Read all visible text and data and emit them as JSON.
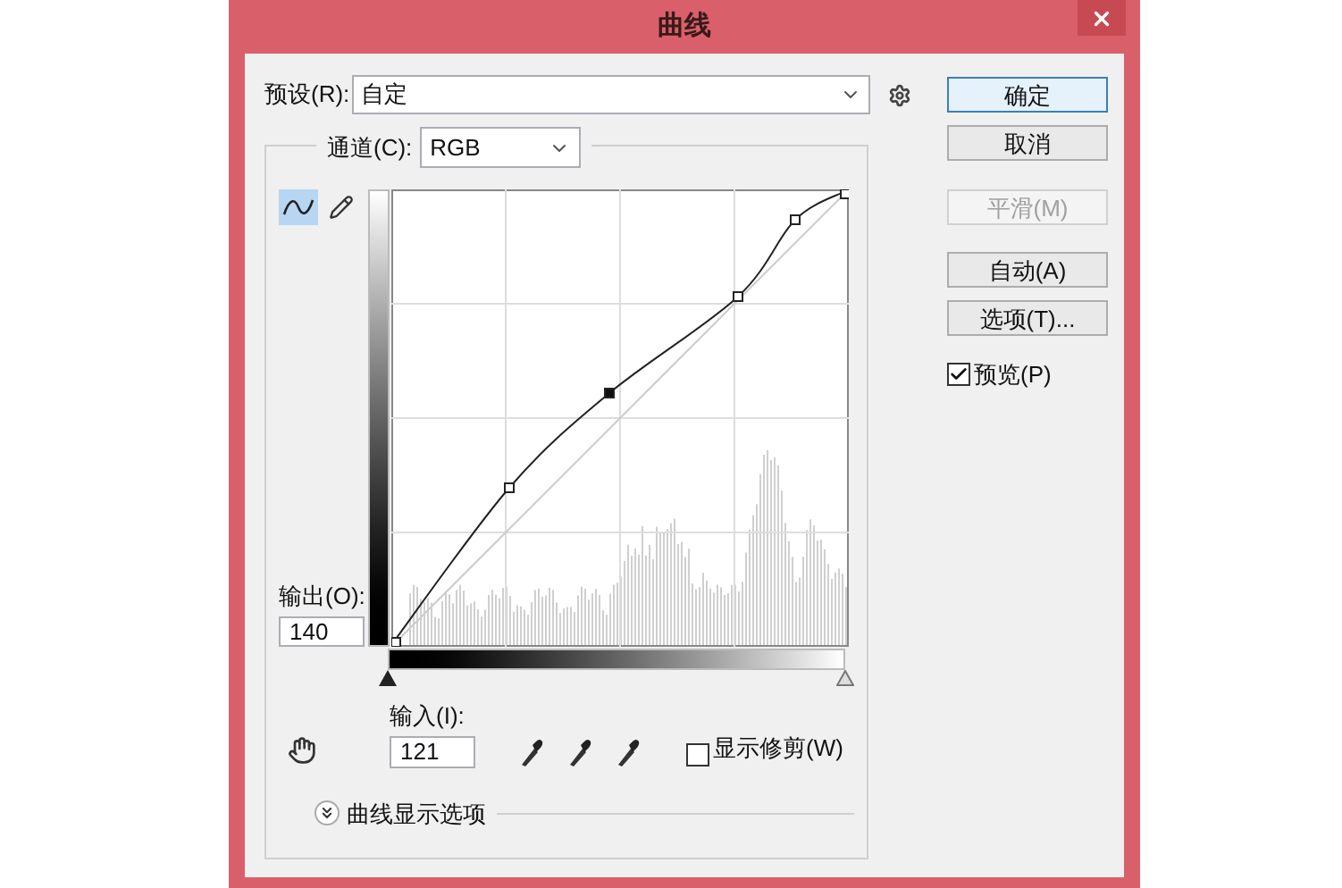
{
  "window": {
    "title": "曲线"
  },
  "preset": {
    "label": "预设(R):",
    "value": "自定"
  },
  "channel": {
    "label": "通道(C):",
    "value": "RGB"
  },
  "tools": [
    {
      "kind": "curve",
      "selected": true
    },
    {
      "kind": "pencil",
      "selected": false
    }
  ],
  "output": {
    "label": "输出(O):",
    "value": "140"
  },
  "input": {
    "label": "输入(I):",
    "value": "121"
  },
  "show_clipping": {
    "label": "显示修剪(W)",
    "checked": false
  },
  "display_options": {
    "label": "曲线显示选项",
    "expanded": false
  },
  "buttons": [
    {
      "label": "确定",
      "default": true,
      "disabled": false
    },
    {
      "label": "取消",
      "default": false,
      "disabled": false
    },
    {
      "label": "平滑(M)",
      "default": false,
      "disabled": true
    },
    {
      "label": "自动(A)",
      "default": false,
      "disabled": false
    },
    {
      "label": "选项(T)...",
      "default": false,
      "disabled": false
    }
  ],
  "preview": {
    "label": "预览(P)",
    "checked": true
  }
}
